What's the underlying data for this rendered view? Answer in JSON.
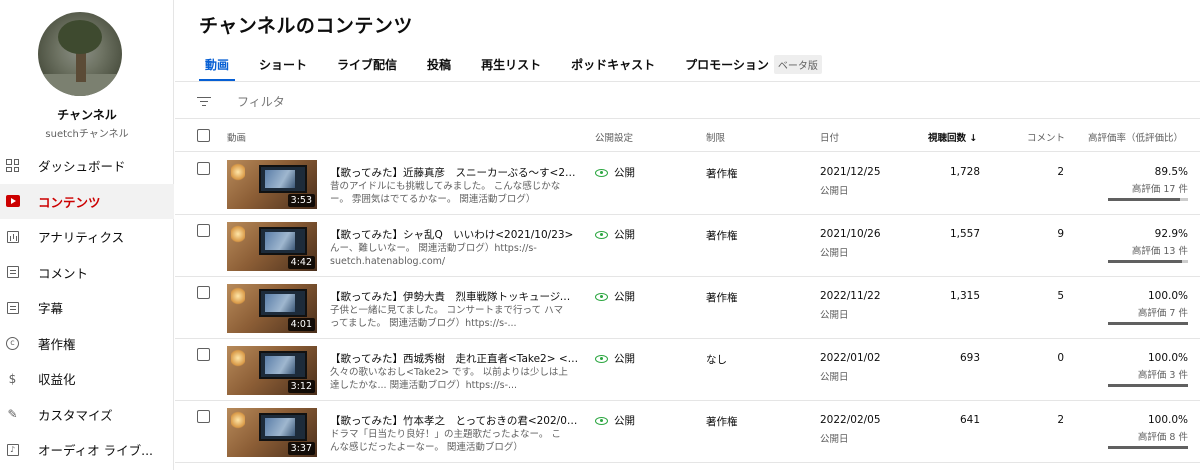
{
  "sidebar": {
    "channel_name": "チャンネル",
    "channel_handle": "suetchチャンネル",
    "items": [
      {
        "label": "ダッシュボード",
        "icon": "dashboard-icon",
        "active": false
      },
      {
        "label": "コンテンツ",
        "icon": "content-icon",
        "active": true
      },
      {
        "label": "アナリティクス",
        "icon": "analytics-icon",
        "active": false
      },
      {
        "label": "コメント",
        "icon": "comments-icon",
        "active": false
      },
      {
        "label": "字幕",
        "icon": "subtitles-icon",
        "active": false
      },
      {
        "label": "著作権",
        "icon": "copyright-icon",
        "active": false
      },
      {
        "label": "収益化",
        "icon": "monetization-icon",
        "active": false
      },
      {
        "label": "カスタマイズ",
        "icon": "customize-icon",
        "active": false
      },
      {
        "label": "オーディオ ライブ...",
        "icon": "audio-library-icon",
        "active": false
      }
    ]
  },
  "main": {
    "title": "チャンネルのコンテンツ",
    "tabs": [
      "動画",
      "ショート",
      "ライブ配信",
      "投稿",
      "再生リスト",
      "ポッドキャスト",
      "プロモーション"
    ],
    "beta_badge": "ベータ版",
    "filter_placeholder": "フィルタ"
  },
  "table": {
    "headers": {
      "video": "動画",
      "visibility": "公開設定",
      "restrictions": "制限",
      "date": "日付",
      "views": "視聴回数",
      "comments": "コメント",
      "likes": "高評価率（低評価比）"
    },
    "rows": [
      {
        "duration": "3:53",
        "title": "【歌ってみた】近藤真彦　スニーカーぶる〜す<202...",
        "desc": "昔のアイドルにも挑戦してみました。 こんな感じかなー。 雰囲気はでてるかなー。 関連活動ブログ）https://s-...",
        "visibility": "公開",
        "restriction": "著作権",
        "date": "2021/12/25",
        "date_sub": "公開日",
        "views": "1,728",
        "comments": "2",
        "like_pct": "89.5%",
        "likes": "高評価 17 件",
        "like_ratio": 0.895
      },
      {
        "duration": "4:42",
        "title": "【歌ってみた】シャ乱Q　いいわけ<2021/10/23>",
        "desc": "んー、難しいなー。 関連活動ブログ）https://s-suetch.hatenablog.com/",
        "visibility": "公開",
        "restriction": "著作権",
        "date": "2021/10/26",
        "date_sub": "公開日",
        "views": "1,557",
        "comments": "9",
        "like_pct": "92.9%",
        "likes": "高評価 13 件",
        "like_ratio": 0.929
      },
      {
        "duration": "4:01",
        "title": "【歌ってみた】伊勢大貴　烈車戦隊トッキュージャー...",
        "desc": "子供と一緒に見てました。 コンサートまで行って ハマってました。 関連活動ブログ）https://s-...",
        "visibility": "公開",
        "restriction": "著作権",
        "date": "2022/11/22",
        "date_sub": "公開日",
        "views": "1,315",
        "comments": "5",
        "like_pct": "100.0%",
        "likes": "高評価 7 件",
        "like_ratio": 1.0
      },
      {
        "duration": "3:12",
        "title": "【歌ってみた】西城秀樹　走れ正直者<Take2> <20...",
        "desc": "久々の歌いなおし<Take2> です。 以前よりは少しは上達したかな... 関連活動ブログ）https://s-...",
        "visibility": "公開",
        "restriction": "なし",
        "date": "2022/01/02",
        "date_sub": "公開日",
        "views": "693",
        "comments": "0",
        "like_pct": "100.0%",
        "likes": "高評価 3 件",
        "like_ratio": 1.0
      },
      {
        "duration": "3:37",
        "title": "【歌ってみた】竹本孝之　とっておきの君<202/01/...",
        "desc": "ドラマ「日当たり良好！」の主題歌だったよなー。 こんな感じだったよーなー。 関連活動ブログ）https://s-...",
        "visibility": "公開",
        "restriction": "著作権",
        "date": "2022/02/05",
        "date_sub": "公開日",
        "views": "641",
        "comments": "2",
        "like_pct": "100.0%",
        "likes": "高評価 8 件",
        "like_ratio": 1.0
      }
    ]
  },
  "colors": {
    "accent": "#065fd4",
    "active_nav": "#cc0000",
    "public_eye": "#2ba640"
  }
}
